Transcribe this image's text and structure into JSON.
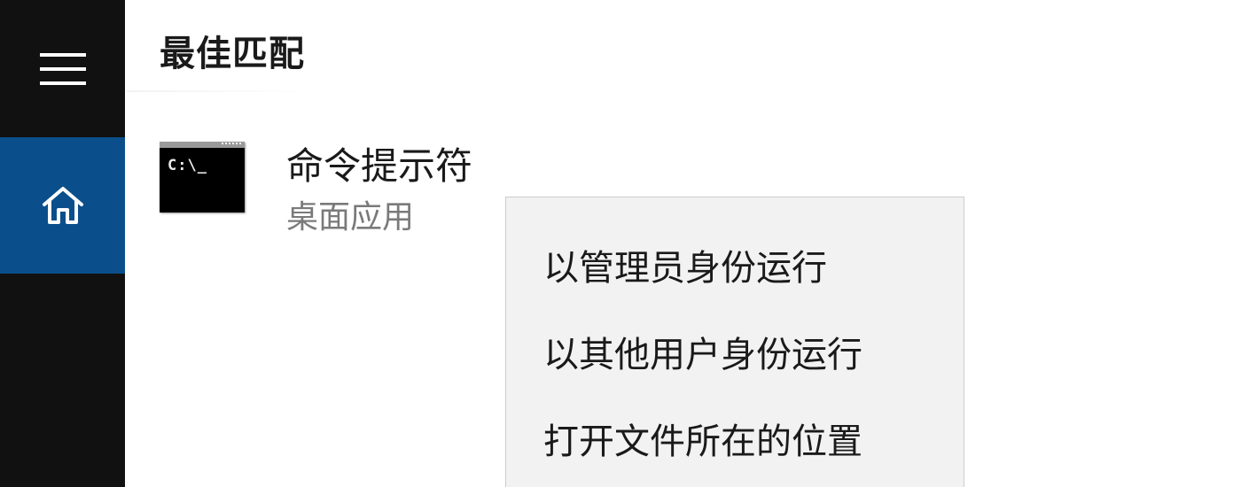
{
  "rail": {
    "menu_icon": "hamburger-menu-icon",
    "home_icon": "home-icon",
    "colors": {
      "rail_bg": "#111111",
      "selected_bg": "#0a4f8c"
    }
  },
  "results": {
    "section_title": "最佳匹配",
    "best_match": {
      "icon": "command-prompt-icon",
      "icon_text": "C:\\_",
      "name": "命令提示符",
      "type": "桌面应用"
    }
  },
  "context_menu": {
    "items": [
      {
        "label": "以管理员身份运行"
      },
      {
        "label": "以其他用户身份运行"
      },
      {
        "label": "打开文件所在的位置"
      }
    ]
  }
}
